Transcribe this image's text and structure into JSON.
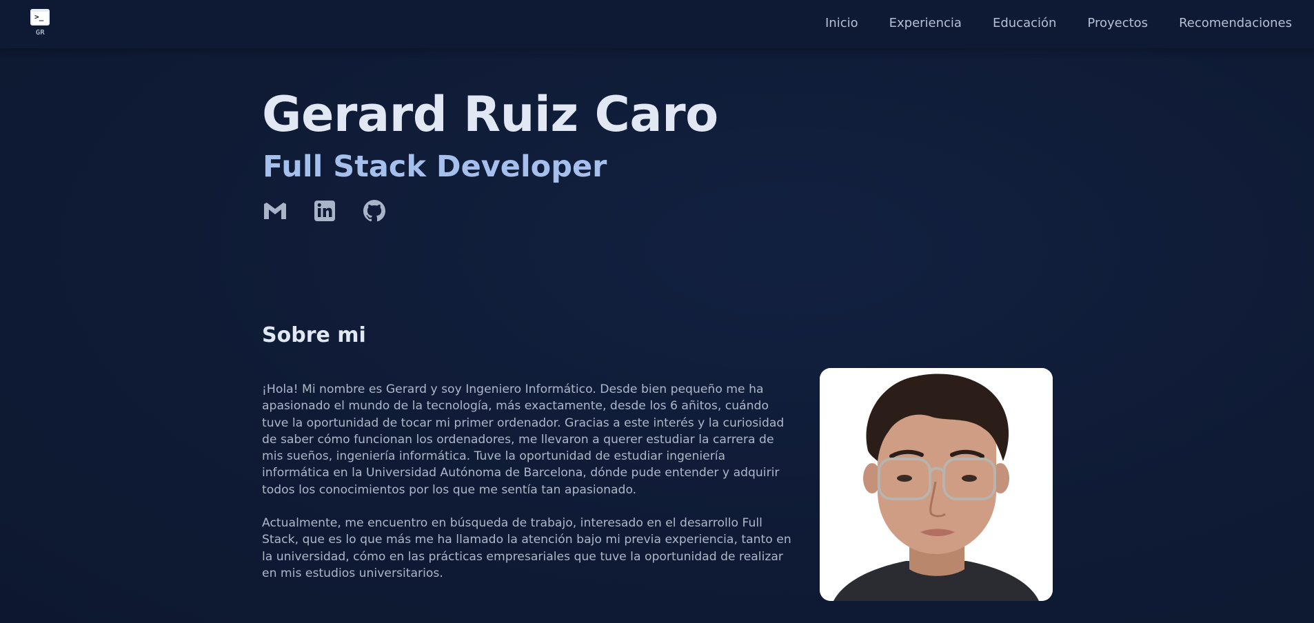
{
  "header": {
    "logo_text": "GR",
    "logo_prompt": ">_",
    "nav": [
      {
        "label": "Inicio"
      },
      {
        "label": "Experiencia"
      },
      {
        "label": "Educación"
      },
      {
        "label": "Proyectos"
      },
      {
        "label": "Recomendaciones"
      }
    ]
  },
  "hero": {
    "name": "Gerard Ruiz Caro",
    "role": "Full Stack Developer",
    "socials": [
      {
        "icon": "gmail-icon"
      },
      {
        "icon": "linkedin-icon"
      },
      {
        "icon": "github-icon"
      }
    ]
  },
  "about": {
    "title": "Sobre mi",
    "paragraphs": [
      "¡Hola! Mi nombre es Gerard y soy Ingeniero Informático. Desde bien pequeño me ha apasionado el mundo de la tecnología, más exactamente, desde los 6 añitos, cuándo tuve la oportunidad de tocar mi primer ordenador. Gracias a este interés y la curiosidad de saber cómo funcionan los ordenadores, me llevaron a querer estudiar la carrera de mis sueños, ingeniería informática. Tuve la oportunidad de estudiar ingeniería informática en la Universidad Autónoma de Barcelona, dónde pude entender y adquirir todos los conocimientos por los que me sentía tan apasionado.",
      "Actualmente, me encuentro en búsqueda de trabajo, interesado en el desarrollo Full Stack, que es lo que más me ha llamado la atención bajo mi previa experiencia, tanto en la universidad, cómo en las prácticas empresariales que tuve la oportunidad de realizar en mis estudios universitarios."
    ]
  },
  "colors": {
    "background": "#0f1b35",
    "header": "#0e1a33",
    "heading": "#e2e8f3",
    "accent": "#a6c0ee",
    "body_text": "#aeb7c9",
    "icon": "#aab4c8"
  }
}
